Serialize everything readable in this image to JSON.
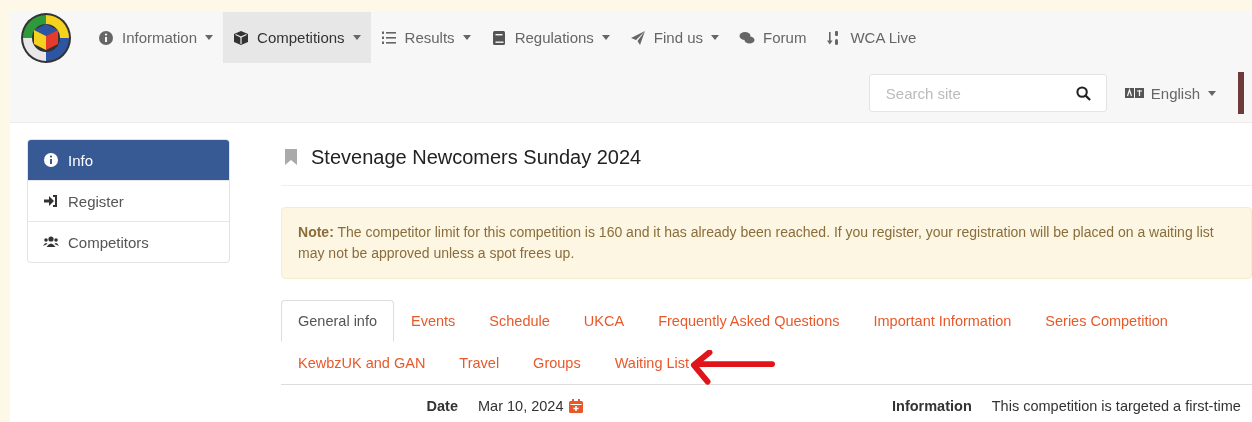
{
  "nav": {
    "items": [
      {
        "label": "Information",
        "kind": "dropdown",
        "selected": false
      },
      {
        "label": "Competitions",
        "kind": "dropdown",
        "selected": true
      },
      {
        "label": "Results",
        "kind": "dropdown",
        "selected": false
      },
      {
        "label": "Regulations",
        "kind": "dropdown",
        "selected": false
      },
      {
        "label": "Find us",
        "kind": "dropdown",
        "selected": false
      },
      {
        "label": "Forum",
        "kind": "link",
        "selected": false
      },
      {
        "label": "WCA Live",
        "kind": "link",
        "selected": false
      }
    ],
    "search": {
      "placeholder": "Search site"
    },
    "language": "English"
  },
  "sidebar": {
    "items": [
      {
        "label": "Info",
        "selected": true
      },
      {
        "label": "Register",
        "selected": false
      },
      {
        "label": "Competitors",
        "selected": false
      }
    ]
  },
  "title": "Stevenage Newcomers Sunday 2024",
  "note": {
    "label": "Note:",
    "lines": [
      "The competitor limit for this competition is 160 and it has already been reached. If you register, your registration will be placed on a waiting list",
      "may not be approved unless a spot frees up."
    ]
  },
  "tabs": [
    {
      "label": "General info",
      "selected": true
    },
    {
      "label": "Events",
      "selected": false
    },
    {
      "label": "Schedule",
      "selected": false
    },
    {
      "label": "UKCA",
      "selected": false
    },
    {
      "label": "Frequently Asked Questions",
      "selected": false
    },
    {
      "label": "Important Information",
      "selected": false
    },
    {
      "label": "Series Competition",
      "selected": false
    },
    {
      "label": "KewbzUK and GAN",
      "selected": false
    },
    {
      "label": "Travel",
      "selected": false
    },
    {
      "label": "Groups",
      "selected": false
    },
    {
      "label": "Waiting List",
      "selected": false
    }
  ],
  "details": {
    "left": {
      "label": "Date",
      "value": "Mar 10, 2024"
    },
    "right": {
      "label": "Information",
      "value": "This competition is targeted a first-time"
    }
  }
}
